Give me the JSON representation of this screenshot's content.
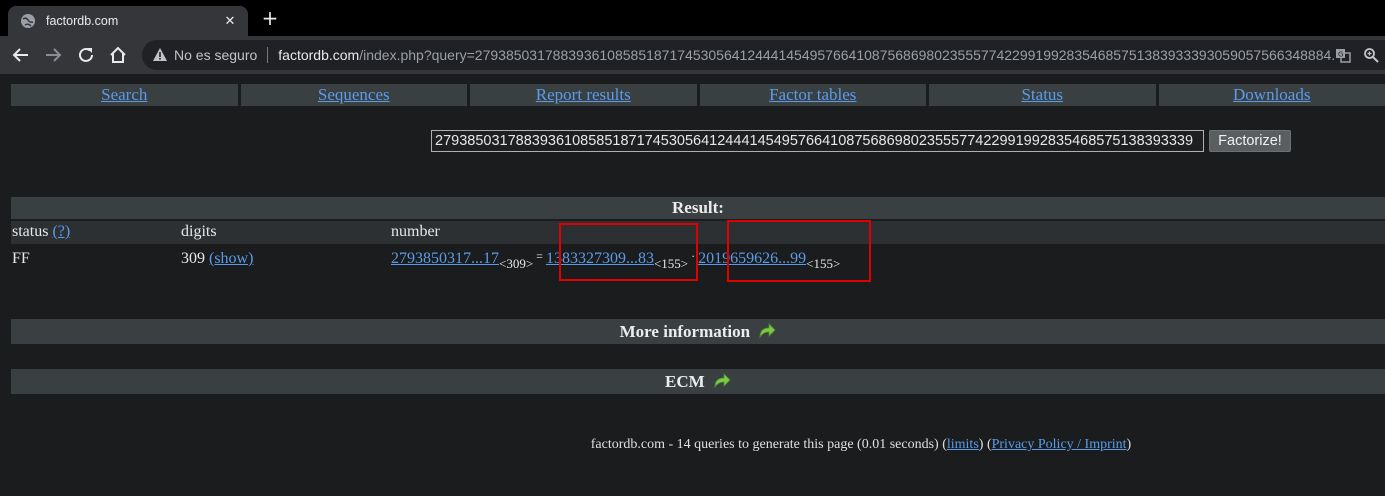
{
  "browser": {
    "tab_title": "factordb.com",
    "tab_close": "✕",
    "new_tab": "+",
    "security_label": "No es seguro",
    "url_host": "factordb.com",
    "url_path": "/index.php?query=27938503178839361085851871745305641244414549576641087568698023555774229919928354685751383933393059057566348884..."
  },
  "nav": {
    "items": [
      {
        "label": "Search"
      },
      {
        "label": "Sequences"
      },
      {
        "label": "Report results"
      },
      {
        "label": "Factor tables"
      },
      {
        "label": "Status"
      },
      {
        "label": "Downloads"
      }
    ]
  },
  "search": {
    "value": "2793850317883936108585187174530564124441454957664108756869802355577422991992835468575138393339",
    "button_label": "Factorize!"
  },
  "result": {
    "heading": "Result:",
    "columns": {
      "status": "status",
      "status_help": "(?)",
      "digits": "digits",
      "number": "number"
    },
    "row": {
      "status": "FF",
      "digits": "309",
      "digits_toggle": "(show)",
      "number": "2793850317...17",
      "number_digits": "<309>",
      "equals": "=",
      "factor1": "1383327309...83",
      "factor1_digits": "<155>",
      "times": "·",
      "factor2": "2019659626...99",
      "factor2_digits": "<155>"
    }
  },
  "sections": {
    "more_info": "More information",
    "ecm": "ECM"
  },
  "footer": {
    "text": "factordb.com - 14 queries to generate this page (0.01 seconds) (",
    "limits": "limits",
    "mid": ") (",
    "privacy": "Privacy Policy / Imprint",
    "end": ")"
  },
  "colors": {
    "link": "#5a9ce8",
    "highlight": "#e00000",
    "header_bg": "#3a3f42",
    "page_bg": "#1b1c1e",
    "arrow": "#7cc94a"
  }
}
